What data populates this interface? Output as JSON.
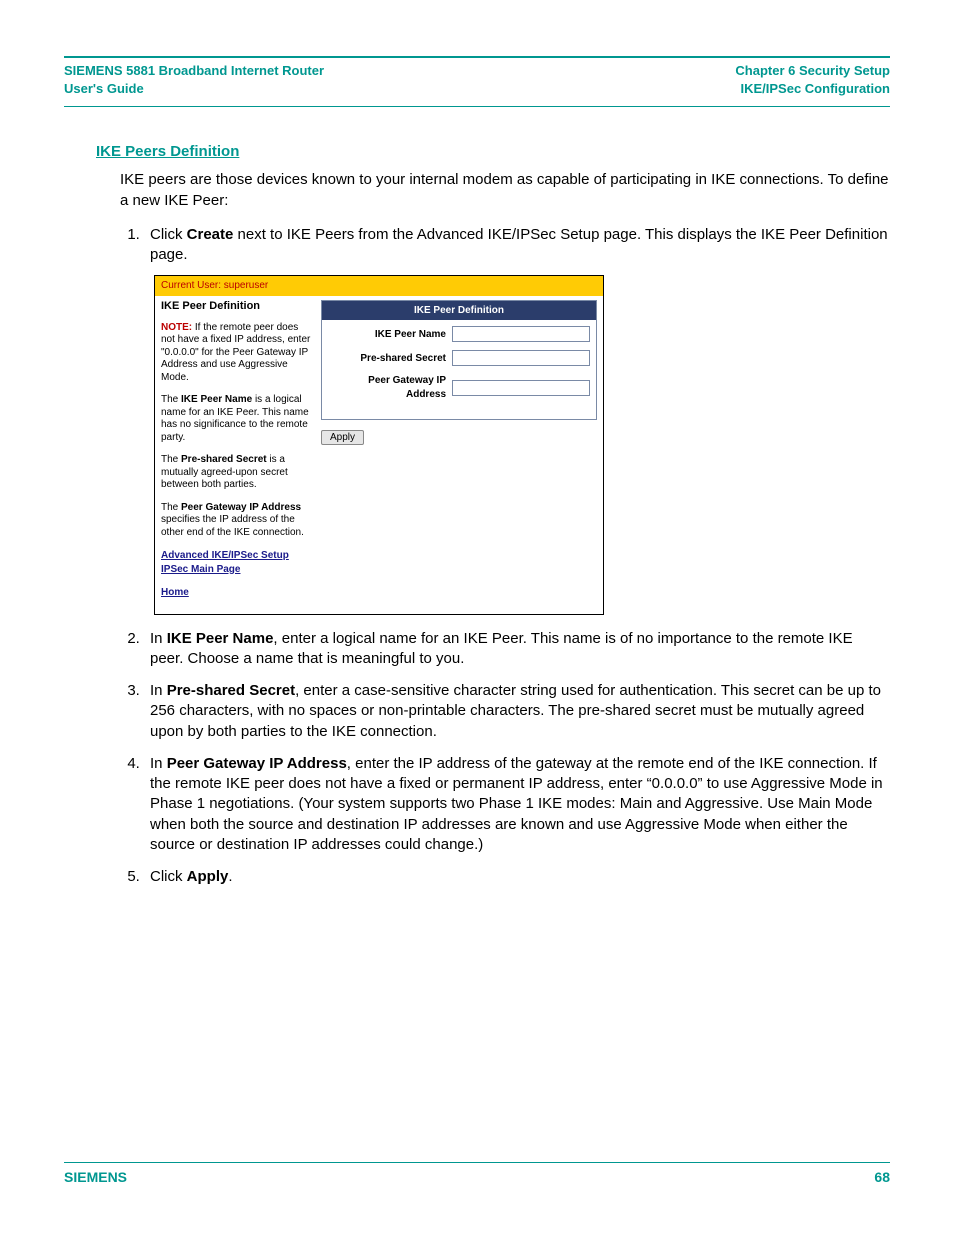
{
  "header": {
    "left_line1": "SIEMENS 5881 Broadband Internet Router",
    "left_line2": "User's Guide",
    "right_line1": "Chapter 6  Security Setup",
    "right_line2": "IKE/IPSec Configuration"
  },
  "section_heading": "IKE Peers Definition",
  "intro": "IKE peers are those devices known to your internal modem as capable of participating in IKE connections. To define a new IKE Peer:",
  "steps": {
    "s1_pre": "Click ",
    "s1_b": "Create",
    "s1_post": " next to IKE Peers from the Advanced IKE/IPSec Setup page. This displays the IKE Peer Definition page.",
    "s2_pre": "In ",
    "s2_b": "IKE Peer Name",
    "s2_post": ", enter a logical name for an IKE Peer. This name is of no importance to the remote IKE peer. Choose a name that is meaningful to you.",
    "s3_pre": "In ",
    "s3_b": "Pre-shared Secret",
    "s3_post": ", enter a case-sensitive character string used for authentication. This secret can be up to 256 characters, with no spaces or non-printable characters. The pre-shared secret must be mutually agreed upon by both parties to the IKE connection.",
    "s4_pre": "In ",
    "s4_b": "Peer Gateway IP Address",
    "s4_post": ", enter the IP address of the gateway at the remote end of the IKE connection. If the remote IKE peer does not have a fixed or permanent IP address, enter “0.0.0.0” to use Aggressive Mode in Phase 1 negotiations. (Your system supports two Phase 1 IKE modes: Main and Aggressive. Use Main Mode when both the source and destination IP addresses are known and use Aggressive Mode when either the source or destination IP addresses could change.)",
    "s5_pre": "Click ",
    "s5_b": "Apply",
    "s5_post": "."
  },
  "app": {
    "current_user": "Current User: superuser",
    "left": {
      "title": "IKE Peer Definition",
      "note_label": "NOTE:",
      "note_text": " If the remote peer does not have a fixed IP address, enter \"0.0.0.0\" for the Peer Gateway IP Address and use Aggressive Mode.",
      "p2_pre": "The ",
      "p2_b": "IKE Peer Name",
      "p2_post": " is a logical name for an IKE Peer. This name has no significance to the remote party.",
      "p3_pre": "The ",
      "p3_b": "Pre-shared Secret",
      "p3_post": " is a mutually agreed-upon secret between both parties.",
      "p4_pre": "The ",
      "p4_b": "Peer Gateway IP Address",
      "p4_post": " specifies the IP address of the other end of the IKE connection.",
      "link1": "Advanced IKE/IPSec Setup",
      "link2": "IPSec Main Page",
      "link3": "Home"
    },
    "form": {
      "panel_title": "IKE Peer Definition",
      "f1_label": "IKE Peer Name",
      "f1_value": "",
      "f2_label": "Pre-shared Secret",
      "f2_value": "",
      "f3_label": "Peer Gateway IP Address",
      "f3_value": "",
      "apply": "Apply"
    }
  },
  "footer": {
    "brand": "SIEMENS",
    "page": "68"
  }
}
